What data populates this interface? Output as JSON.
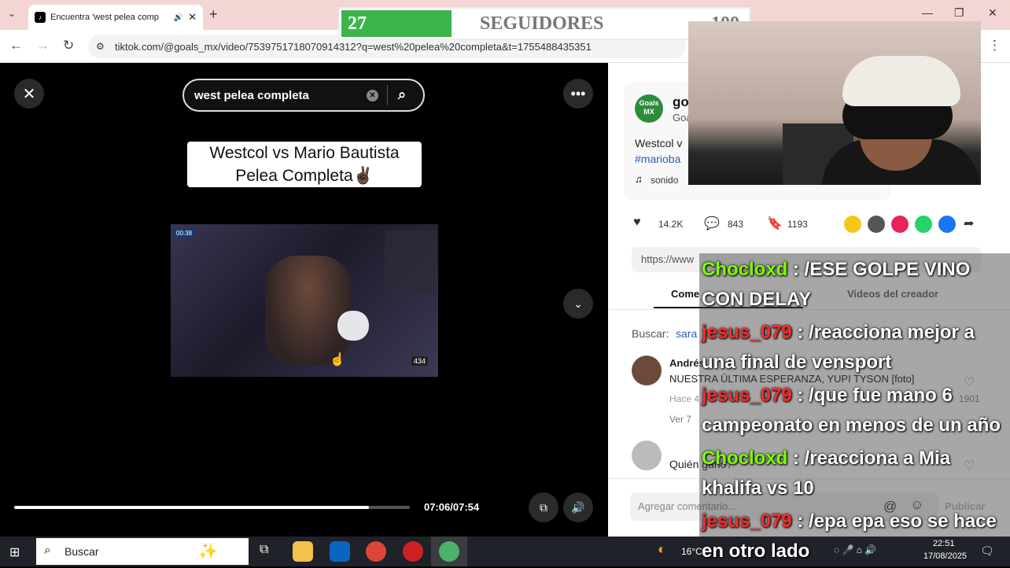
{
  "browser": {
    "tab_title": "Encuentra 'west pelea comp",
    "url": "tiktok.com/@goals_mx/video/7539751718070914312?q=west%20pelea%20completa&t=1755488435351"
  },
  "video": {
    "search_query": "west pelea completa",
    "caption_line1": "Westcol vs Mario Bautista",
    "caption_line2": "Pelea Completa✌🏿",
    "time": "07:06/07:54",
    "progress": 0.897,
    "clip_badge_time": "00:38",
    "clip_viewers": "434"
  },
  "post": {
    "avatar_text": "Goals MX",
    "author_name": "go",
    "author_handle": "Goa",
    "description": "Westcol v",
    "hashtag": "#marioba",
    "sound": "sonido",
    "likes": "14.2K",
    "comments": "843",
    "saves": "1193",
    "link": "https://www",
    "tab_comments": "Come",
    "tab_creator": "Videos del creador",
    "search_label": "Buscar:",
    "search_term": "sara"
  },
  "comments_list": [
    {
      "name": "Andrés",
      "text": "NUESTRA ÚLTIMA ESPERANZA, YUPI TYSON [foto]",
      "meta": "Hace 4",
      "replies": "Ver 7",
      "likes": "1901"
    },
    {
      "name": "",
      "text": "Quién ganó?",
      "meta": "",
      "replies": "",
      "likes": ""
    }
  ],
  "composer": {
    "placeholder": "Agregar comentario...",
    "post_label": "Publicar"
  },
  "overlay": {
    "count": "27",
    "label": "SEGUIDORES",
    "goal": "100",
    "fill": 0.27,
    "color": "#3cb44b"
  },
  "chat": [
    {
      "user": "Chocloxd",
      "color": "green",
      "text": ": /ESE GOLPE VINO CON DELAY"
    },
    {
      "user": "jesus_079",
      "color": "red",
      "text": ": /reacciona mejor a una final de vensport"
    },
    {
      "user": "jesus_079",
      "color": "red",
      "text": ": /que fue mano 6 campeonato en menos de un año"
    },
    {
      "user": "Chocloxd",
      "color": "green",
      "text": ": /reacciona a Mia khalifa vs 10"
    },
    {
      "user": "jesus_079",
      "color": "red",
      "text": ": /epa epa eso se hace en otro lado"
    }
  ],
  "taskbar": {
    "search": "Buscar",
    "weather": "16°C",
    "time": "22:51",
    "date": "17/08/2025"
  }
}
